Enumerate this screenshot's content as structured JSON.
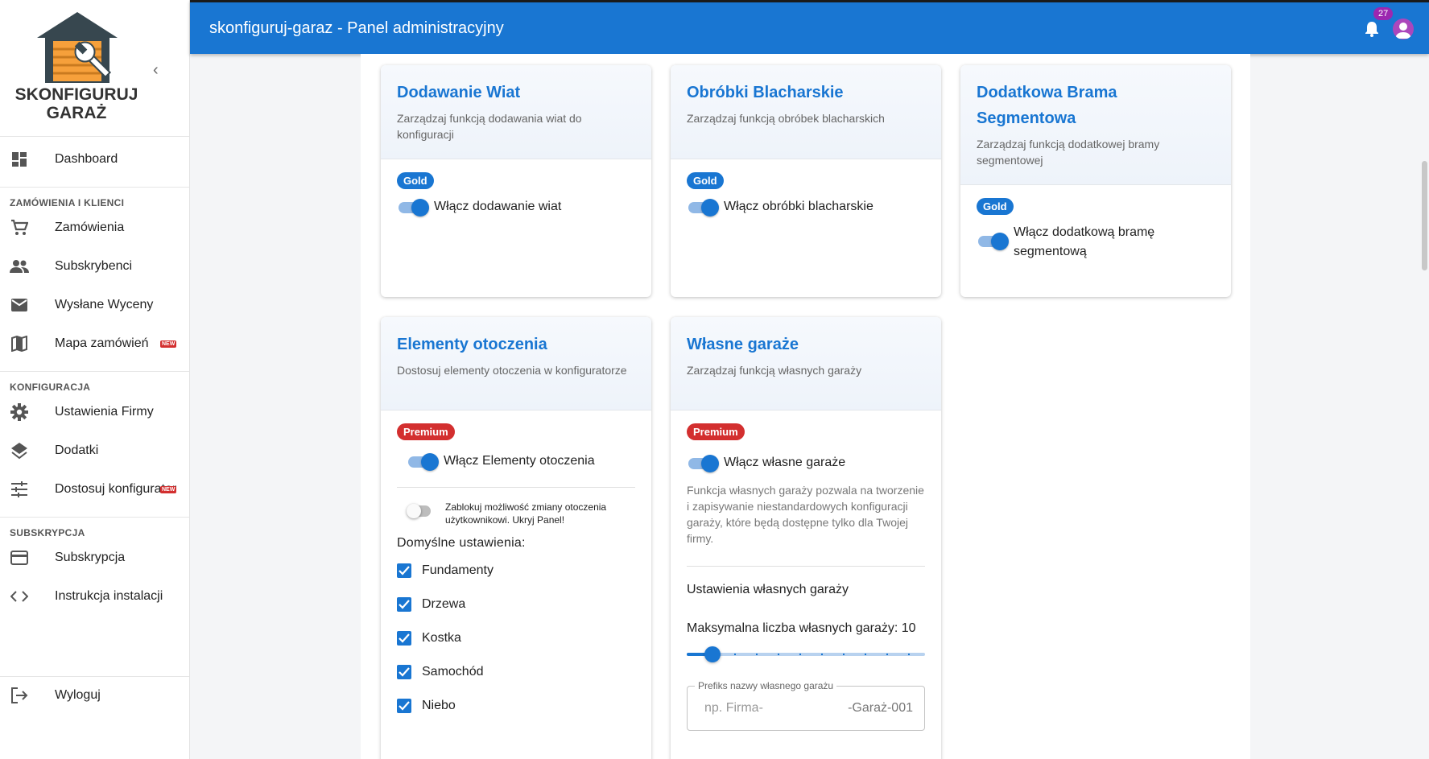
{
  "app": {
    "logo_text": "SKONFIGURUJ GARAŻ",
    "header_title": "skonfiguruj-garaz - Panel administracyjny",
    "notification_count": "27"
  },
  "sidebar": {
    "dashboard": "Dashboard",
    "section_orders": "ZAMÓWIENIA I KLIENCI",
    "orders": "Zamówienia",
    "subscribers": "Subskrybenci",
    "sent_quotes": "Wysłane Wyceny",
    "orders_map": "Mapa zamówień",
    "new_badge": "NEW",
    "section_config": "KONFIGURACJA",
    "company_settings": "Ustawienia Firmy",
    "addons": "Dodatki",
    "customize_configurator": "Dostosuj konfigurator",
    "section_subscription": "SUBSKRYPCJA",
    "subscription": "Subskrypcja",
    "install_guide": "Instrukcja instalacji",
    "logout": "Wyloguj"
  },
  "cards": {
    "carports": {
      "title": "Dodawanie Wiat",
      "desc": "Zarządzaj funkcją dodawania wiat do konfiguracji",
      "badge": "Gold",
      "toggle": "Włącz dodawanie wiat"
    },
    "flashing": {
      "title": "Obróbki Blacharskie",
      "desc": "Zarządzaj funkcją obróbek blacharskich",
      "badge": "Gold",
      "toggle": "Włącz obróbki blacharskie"
    },
    "extra_gate": {
      "title": "Dodatkowa Brama Segmentowa",
      "desc": "Zarządzaj funkcją dodatkowej bramy segmentowej",
      "badge": "Gold",
      "toggle": "Włącz dodatkową bramę segmentową"
    },
    "surroundings": {
      "title": "Elementy otoczenia",
      "desc": "Dostosuj elementy otoczenia w konfiguratorze",
      "badge": "Premium",
      "toggle": "Włącz Elementy otoczenia",
      "lock_toggle": "Zablokuj możliwość zmiany otoczenia użytkownikowi. Ukryj Panel!",
      "defaults_label": "Domyślne ustawienia:",
      "checkboxes": [
        "Fundamenty",
        "Drzewa",
        "Kostka",
        "Samochód",
        "Niebo"
      ]
    },
    "own_garages": {
      "title": "Własne garaże",
      "desc": "Zarządzaj funkcją własnych garaży",
      "badge": "Premium",
      "toggle": "Włącz własne garaże",
      "info": "Funkcja własnych garaży pozwala na tworzenie i zapisywanie niestandardowych konfiguracji garaży, które będą dostępne tylko dla Twojej firmy.",
      "settings_title": "Ustawienia własnych garaży",
      "max_label": "Maksymalna liczba własnych garaży: 10",
      "slider_value": 10,
      "slider_min": 10,
      "slider_max": 100,
      "slider_steps": 10,
      "prefix_label": "Prefiks nazwy własnego garażu",
      "prefix_placeholder": "np. Firma-",
      "prefix_suffix": "-Garaż-001"
    }
  },
  "colors": {
    "primary": "#1976d2",
    "gold_badge": "#1976d2",
    "premium_badge": "#d32f2f",
    "notification_badge": "#9c27b0"
  }
}
